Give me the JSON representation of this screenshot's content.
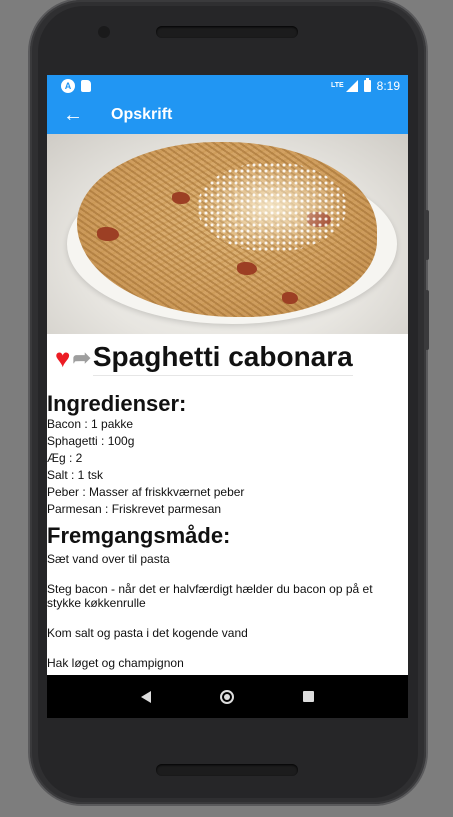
{
  "status_bar": {
    "network": "LTE",
    "time": "8:19",
    "icons": [
      "android-notification-icon",
      "sd-card-icon",
      "signal-icon",
      "battery-icon"
    ]
  },
  "app_bar": {
    "title": "Opskrift",
    "back_icon": "arrow-left-icon"
  },
  "recipe": {
    "title": "Spaghetti cabonara",
    "favorite_icon": "heart-icon",
    "share_icon": "share-icon",
    "ingredients_heading": "Ingredienser:",
    "ingredients": [
      "Bacon : 1 pakke",
      "Sphagetti : 100g",
      "Æg : 2",
      "Salt : 1 tsk",
      "Peber : Masser af friskkværnet peber",
      "Parmesan : Friskrevet parmesan"
    ],
    "method_heading": "Fremgangsmåde:",
    "steps": [
      "Sæt vand over til pasta",
      "Steg bacon - når det er halvfærdigt hælder du bacon op på et stykke køkkenrulle",
      "Kom salt og pasta i det kogende vand",
      "Hak løget og champignon"
    ]
  },
  "colors": {
    "primary": "#2196f3",
    "heart": "#ec1c24",
    "share": "#9e9e9e"
  }
}
